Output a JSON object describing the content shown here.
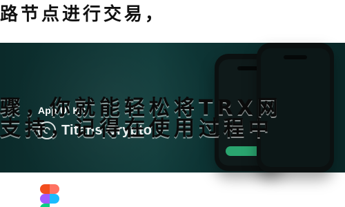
{
  "overlay": {
    "line_top": "路节点进行交易，",
    "line_mid1": "骤，你就能轻松将TRX网",
    "line_mid2": "支持，记得在使用过程中"
  },
  "banner": {
    "kit_title": "App UI Kit",
    "brand_name": "Titans Crypto",
    "colors": {
      "bg": "#0f3b3a",
      "cta": "#2aa56f"
    },
    "icons": {
      "brand": "brand-logo-icon",
      "figma": "figma-icon"
    }
  }
}
